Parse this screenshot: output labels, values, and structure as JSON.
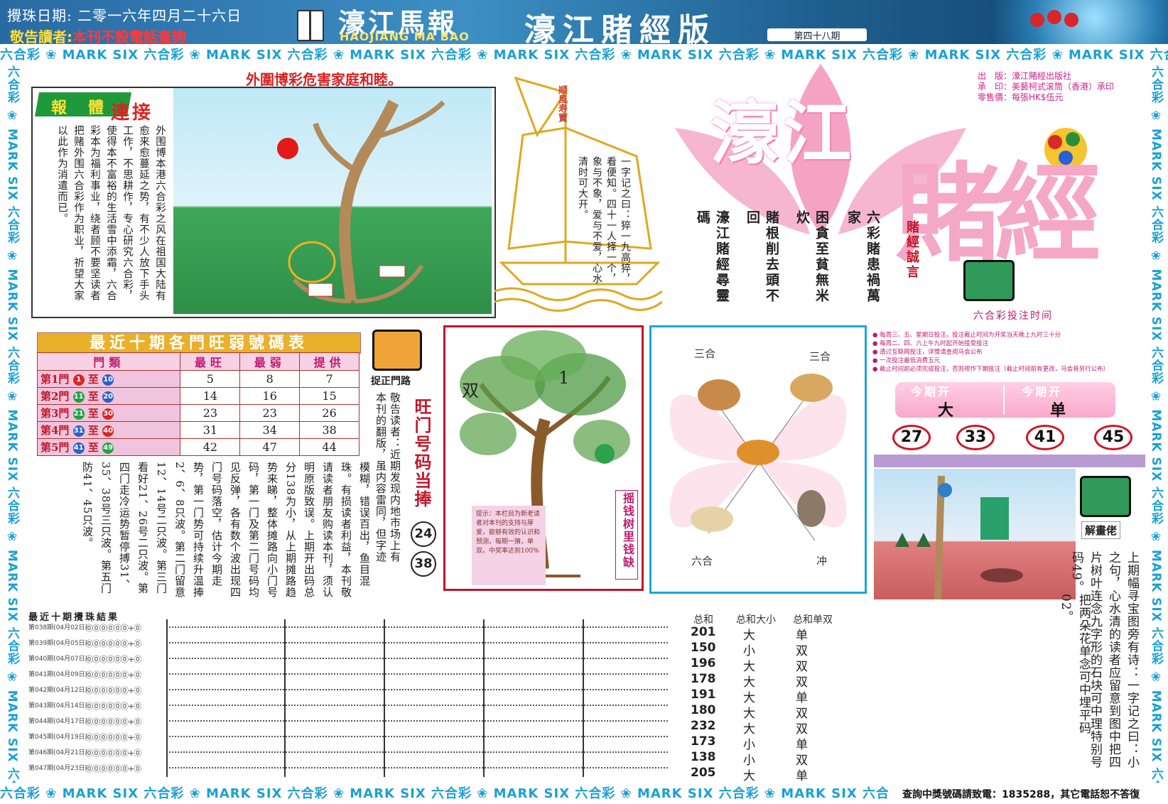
{
  "header": {
    "date": "攪珠日期: 二零一六年四月二十六日",
    "notice_prefix": "敬告讀者:",
    "notice_text": "本刊不設電話查詢",
    "paper_name": "濠江馬報",
    "paper_en": "HAOJIANG MA BAO",
    "edition": "濠江賭經版",
    "issue": "第四十八期"
  },
  "strip_text": "六合彩 ❀ MARK SIX 六合彩 ❀ MARK SIX 六合彩 ❀ MARK SIX 六合彩 ❀ MARK SIX 六合彩 ❀ MARK SIX 六合彩 ❀ MARK SIX 六合彩 ❀ MARK SIX 六合彩 ❀ MARK SIX 六合彩 ❀ MARK SIX 六合彩 ❀ MARK SIX",
  "panel1": {
    "title": "外圍博彩危害家庭和睦。",
    "tag1": "報",
    "tag2": "體",
    "tag3": "連接",
    "text": "外围博本港六合彩之风在祖国大陆有愈来愈蔓延之势，有不少人放下手头工作，不思耕作，专心研究六合彩，使得本不富裕的生活雪中添霜，六合彩本为福利事业，绕者顾不要坚读者把赌外围六合彩作为职业，祈望大家以此作为消遣而已。"
  },
  "sail": {
    "flag": "顺風寿寶",
    "text": "一字记之曰：猝一九高猝，看便知。四十一人择一个，象与不象，爱与不爱，心水清时可大开。"
  },
  "title_block": {
    "big1": "濠江",
    "big2": "賭經",
    "pub_lines": [
      "出　版：濠江賭經出版社",
      "承　印：美藝柯式滚筒（香港）承印",
      "零售價：每張HK$伍元"
    ],
    "poem": [
      "六彩賭患禍萬家",
      "困貪至貧無米炊",
      "賭根削去頭不回",
      "濠江賭經尋靈碼"
    ],
    "motto": "賭經誠言",
    "time_title": "六合彩投注时间"
  },
  "table1": {
    "title": "最近十期各門旺弱號碼表",
    "headers": [
      "門類",
      "最旺",
      "最弱",
      "提供"
    ],
    "rows": [
      {
        "gate": "第1門",
        "from": "1",
        "to": "10",
        "hot": "5",
        "cold": "8",
        "offer": "7"
      },
      {
        "gate": "第2門",
        "from": "11",
        "to": "20",
        "hot": "14",
        "cold": "16",
        "offer": "15"
      },
      {
        "gate": "第3門",
        "from": "21",
        "to": "30",
        "hot": "23",
        "cold": "23",
        "offer": "26"
      },
      {
        "gate": "第4門",
        "from": "31",
        "to": "40",
        "hot": "31",
        "cold": "34",
        "offer": "38"
      },
      {
        "gate": "第5門",
        "from": "41",
        "to": "49",
        "hot": "42",
        "cold": "47",
        "offer": "44"
      }
    ],
    "to_word": "至"
  },
  "gate_section": {
    "label": "捉正門路",
    "notice": "敬告读者：近期发现内地市场上有本刊的翻版，虽内容雷同，但字迹",
    "hot_label": "旺门号码当捧",
    "num_a": "24",
    "num_b": "38",
    "long_text": "模糊，错误百出，鱼目混珠。有损读者利益，本刊敬请读者朋友购读本刊，须认明原版致误。上期开出码总分138为小，从上期摊路趋势来睇，整体摊路向小门号码，第一门及第二门号码均见反弹，各有数个波出现四门号码落空，估计今期走势，第一门势可持续升温捧2、6、8只波。第二门留意12、14号二只波。第三门看好21、26号二只波。第四门走冷运势暂停搏31、35、38号三只波。第五门防41、45只波。"
  },
  "tree_panel": {
    "left_char": "双",
    "right_char": "1",
    "note": "提示：本栏目为新老读者对本刊的支持与厚爱，能够有效的认识和预测，每期一猜，单双。中奖率达到100%",
    "label": "摇钱树里钱缺"
  },
  "zodiac": {
    "top_left": "三合",
    "top_right": "三合",
    "bottom_left": "六合",
    "bottom_right": "冲"
  },
  "rules": [
    "● 每周三、五、星期日投注，投注截止时间为开奖当天晚上九时三十分",
    "● 每周二、四、六上午九时起开始接受投注",
    "● 透过互联网投注，详情请查阅马会公布",
    "● 一次投注最低消费五元",
    "● 截止时间前必须完成投注，否则视作下期投注（截止时间前有更改，马会将另行公布）"
  ],
  "open": {
    "cap1": "今期开",
    "val1": "大",
    "cap2": "今期开",
    "val2": "单",
    "balls": [
      "27",
      "33",
      "41",
      "45"
    ]
  },
  "picture_clue": {
    "label": "解畫佬",
    "text": "上期幅寻宝图旁有诗：一字记之曰：小之句，心水清的读者应留意到图中把四片树叶连念九字形的石块可中理特别号码49。",
    "tip": "把两朵花单念可中埋平码02。"
  },
  "results": {
    "title": "最近十期攪珠結果",
    "rows": [
      {
        "period": "第038期(04月02日)",
        "sum": "201",
        "size": "大",
        "parity": "单"
      },
      {
        "period": "第039期(04月05日)",
        "sum": "150",
        "size": "小",
        "parity": "双"
      },
      {
        "period": "第040期(04月07日)",
        "sum": "196",
        "size": "大",
        "parity": "双"
      },
      {
        "period": "第041期(04月09日)",
        "sum": "178",
        "size": "大",
        "parity": "双"
      },
      {
        "period": "第042期(04月12日)",
        "sum": "191",
        "size": "大",
        "parity": "单"
      },
      {
        "period": "第043期(04月14日)",
        "sum": "180",
        "size": "大",
        "parity": "双"
      },
      {
        "period": "第044期(04月17日)",
        "sum": "232",
        "size": "大",
        "parity": "双"
      },
      {
        "period": "第045期(04月19日)",
        "sum": "173",
        "size": "小",
        "parity": "单"
      },
      {
        "period": "第046期(04月21日)",
        "sum": "138",
        "size": "小",
        "parity": "双"
      },
      {
        "period": "第047期(04月23日)",
        "sum": "205",
        "size": "大",
        "parity": "单"
      }
    ],
    "h_sum": "总和",
    "h_size": "总和大小",
    "h_parity": "总和单双"
  },
  "footer": {
    "note": "查詢中獎號碼請致電：1835288，其它電話恕不答復"
  }
}
